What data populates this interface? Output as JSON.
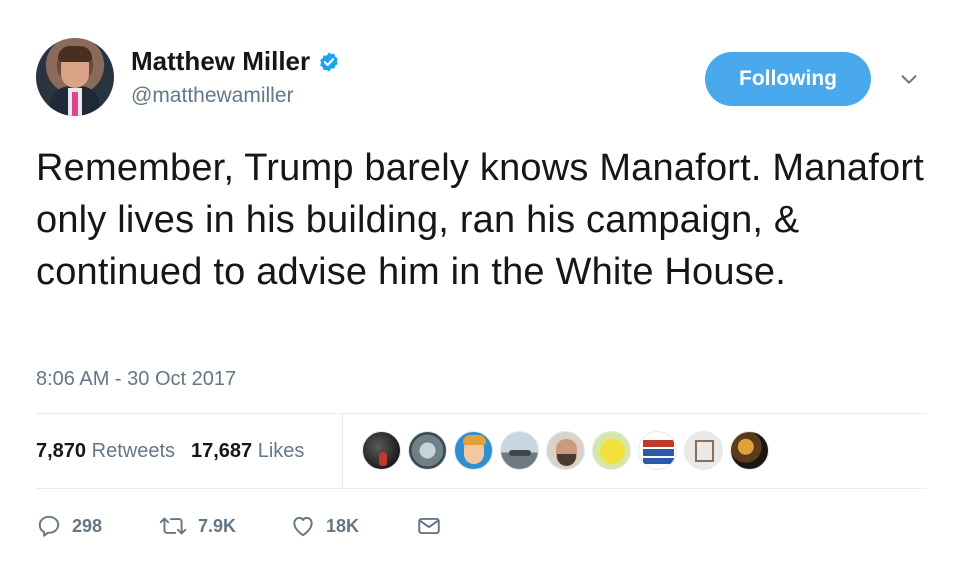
{
  "user": {
    "display_name": "Matthew Miller",
    "handle": "@matthewamiller",
    "verified": true,
    "follow_button_label": "Following"
  },
  "tweet": {
    "text": "Remember, Trump barely knows Manafort. Manafort only lives in his building, ran his campaign, & continued to advise him in the White House.",
    "timestamp": "8:06 AM - 30 Oct 2017"
  },
  "stats": {
    "retweets_count": "7,870",
    "retweets_label": "Retweets",
    "likes_count": "17,687",
    "likes_label": "Likes"
  },
  "likers": [
    {
      "icon": "liker-avatar"
    },
    {
      "icon": "liker-avatar"
    },
    {
      "icon": "liker-avatar"
    },
    {
      "icon": "liker-avatar"
    },
    {
      "icon": "liker-avatar"
    },
    {
      "icon": "liker-avatar"
    },
    {
      "icon": "liker-avatar"
    },
    {
      "icon": "liker-avatar"
    },
    {
      "icon": "liker-avatar"
    }
  ],
  "actions": {
    "replies": "298",
    "retweets": "7.9K",
    "likes": "18K"
  },
  "colors": {
    "accent": "#4aa8ec",
    "text_primary": "#14171a",
    "text_secondary": "#657786",
    "verified": "#1da1f2",
    "divider": "#e6ecf0"
  }
}
